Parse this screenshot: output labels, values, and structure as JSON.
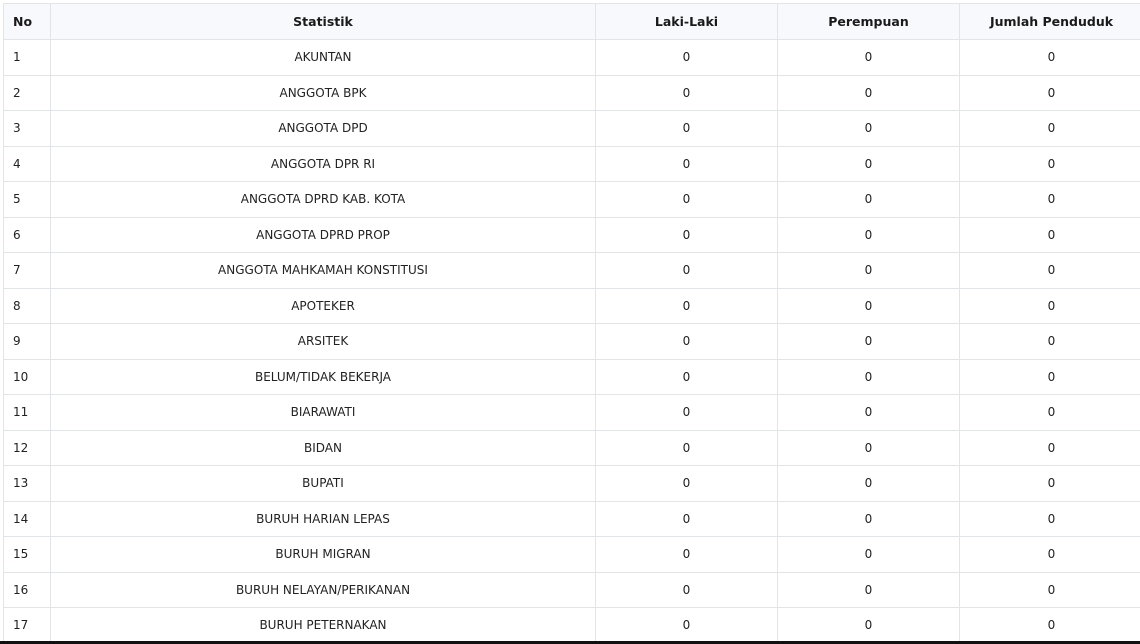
{
  "table": {
    "headers": {
      "no": "No",
      "statistik": "Statistik",
      "laki": "Laki-Laki",
      "perempuan": "Perempuan",
      "jumlah": "Jumlah Penduduk"
    },
    "rows": [
      {
        "no": "1",
        "statistik": "AKUNTAN",
        "laki": "0",
        "perempuan": "0",
        "jumlah": "0"
      },
      {
        "no": "2",
        "statistik": "ANGGOTA BPK",
        "laki": "0",
        "perempuan": "0",
        "jumlah": "0"
      },
      {
        "no": "3",
        "statistik": "ANGGOTA DPD",
        "laki": "0",
        "perempuan": "0",
        "jumlah": "0"
      },
      {
        "no": "4",
        "statistik": "ANGGOTA DPR RI",
        "laki": "0",
        "perempuan": "0",
        "jumlah": "0"
      },
      {
        "no": "5",
        "statistik": "ANGGOTA DPRD KAB. KOTA",
        "laki": "0",
        "perempuan": "0",
        "jumlah": "0"
      },
      {
        "no": "6",
        "statistik": "ANGGOTA DPRD PROP",
        "laki": "0",
        "perempuan": "0",
        "jumlah": "0"
      },
      {
        "no": "7",
        "statistik": "ANGGOTA MAHKAMAH KONSTITUSI",
        "laki": "0",
        "perempuan": "0",
        "jumlah": "0"
      },
      {
        "no": "8",
        "statistik": "APOTEKER",
        "laki": "0",
        "perempuan": "0",
        "jumlah": "0"
      },
      {
        "no": "9",
        "statistik": "ARSITEK",
        "laki": "0",
        "perempuan": "0",
        "jumlah": "0"
      },
      {
        "no": "10",
        "statistik": "BELUM/TIDAK BEKERJA",
        "laki": "0",
        "perempuan": "0",
        "jumlah": "0"
      },
      {
        "no": "11",
        "statistik": "BIARAWATI",
        "laki": "0",
        "perempuan": "0",
        "jumlah": "0"
      },
      {
        "no": "12",
        "statistik": "BIDAN",
        "laki": "0",
        "perempuan": "0",
        "jumlah": "0"
      },
      {
        "no": "13",
        "statistik": "BUPATI",
        "laki": "0",
        "perempuan": "0",
        "jumlah": "0"
      },
      {
        "no": "14",
        "statistik": "BURUH HARIAN LEPAS",
        "laki": "0",
        "perempuan": "0",
        "jumlah": "0"
      },
      {
        "no": "15",
        "statistik": "BURUH MIGRAN",
        "laki": "0",
        "perempuan": "0",
        "jumlah": "0"
      },
      {
        "no": "16",
        "statistik": "BURUH NELAYAN/PERIKANAN",
        "laki": "0",
        "perempuan": "0",
        "jumlah": "0"
      },
      {
        "no": "17",
        "statistik": "BURUH PETERNAKAN",
        "laki": "0",
        "perempuan": "0",
        "jumlah": "0"
      }
    ]
  }
}
